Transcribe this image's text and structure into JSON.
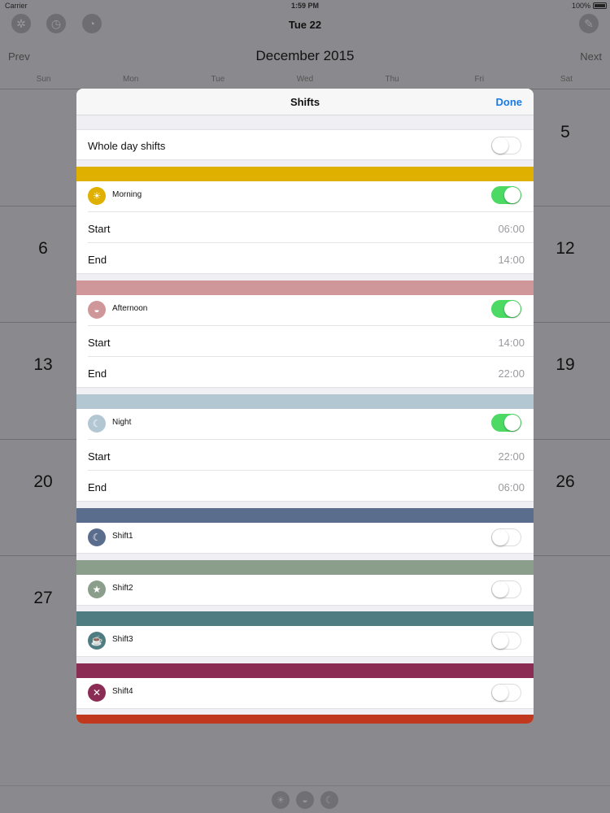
{
  "status_bar": {
    "carrier": "Carrier",
    "time": "1:59 PM",
    "battery": "100%"
  },
  "top_bar": {
    "date": "Tue 22",
    "icons": [
      "gear-icon",
      "clock-icon",
      "clock-history-icon",
      "brush-icon"
    ]
  },
  "calendar": {
    "prev": "Prev",
    "next": "Next",
    "month": "December 2015",
    "weekdays": [
      "Sun",
      "Mon",
      "Tue",
      "Wed",
      "Thu",
      "Fri",
      "Sat"
    ],
    "visible_days": {
      "row1_sat": "5",
      "row2_sun": "6",
      "row2_sat": "12",
      "row3_sun": "13",
      "row3_sat": "19",
      "row4_sun": "20",
      "row4_sat": "26",
      "row5_sun": "27"
    }
  },
  "modal": {
    "title": "Shifts",
    "done": "Done",
    "whole_day_label": "Whole day shifts",
    "whole_day_on": false,
    "start_label": "Start",
    "end_label": "End",
    "shifts": [
      {
        "name": "Morning",
        "icon": "sun-icon",
        "color": "#e0b000",
        "enabled": true,
        "start": "06:00",
        "end": "14:00"
      },
      {
        "name": "Afternoon",
        "icon": "sunset-icon",
        "color": "#cf9799",
        "enabled": true,
        "start": "14:00",
        "end": "22:00"
      },
      {
        "name": "Night",
        "icon": "moon-icon",
        "color": "#b3c7d3",
        "enabled": true,
        "start": "22:00",
        "end": "06:00"
      },
      {
        "name": "Shift1",
        "icon": "moon-cloud-icon",
        "color": "#5b6d8d",
        "enabled": false
      },
      {
        "name": "Shift2",
        "icon": "star-icon",
        "color": "#8a9e8b",
        "enabled": false
      },
      {
        "name": "Shift3",
        "icon": "coffee-cup-icon",
        "color": "#4f7c80",
        "enabled": false
      },
      {
        "name": "Shift4",
        "icon": "fork-knife-icon",
        "color": "#8b2c55",
        "enabled": false
      }
    ],
    "bottom_band_color": "#c0391f"
  },
  "bottom_bar": {
    "icons": [
      "sun-icon",
      "sunset-icon",
      "moon-icon"
    ]
  }
}
